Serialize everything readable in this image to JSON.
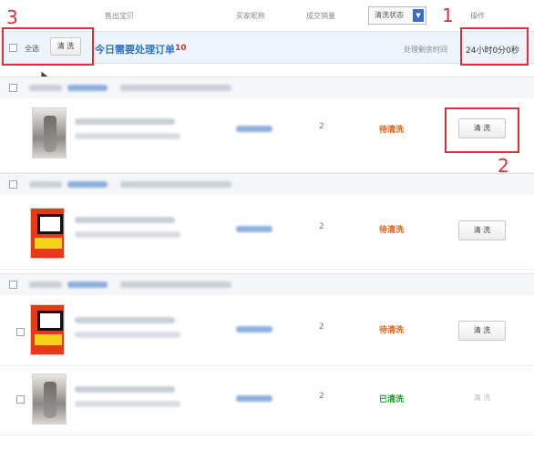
{
  "columns": {
    "item": "售出宝贝",
    "buyer": "买家昵称",
    "quantity": "成交销量",
    "status_filter": "清洗状态",
    "action": "操作"
  },
  "toolbar": {
    "select_all": "全选",
    "wash_button": "清 洗",
    "today_title": "今日需要处理订单",
    "today_count": "10",
    "remain_label": "处理剩余时间",
    "remain_time": "24小时0分0秒"
  },
  "orders": [
    {
      "qty": "2",
      "status": "待清洗",
      "action": "清 洗",
      "thumb": "dress"
    },
    {
      "qty": "2",
      "status": "待清洗",
      "action": "清 洗",
      "thumb": "book"
    },
    {
      "qty": "2",
      "status": "待清洗",
      "action": "清 洗",
      "thumb": "book"
    },
    {
      "qty": "2",
      "status": "已清洗",
      "action": "清 洗",
      "thumb": "dress"
    }
  ],
  "annotations": [
    "1",
    "2",
    "3"
  ],
  "colors": {
    "accent_blue": "#2f73c6",
    "pending": "#e0621b",
    "done": "#1f9e2a",
    "annotation": "#e03036"
  }
}
